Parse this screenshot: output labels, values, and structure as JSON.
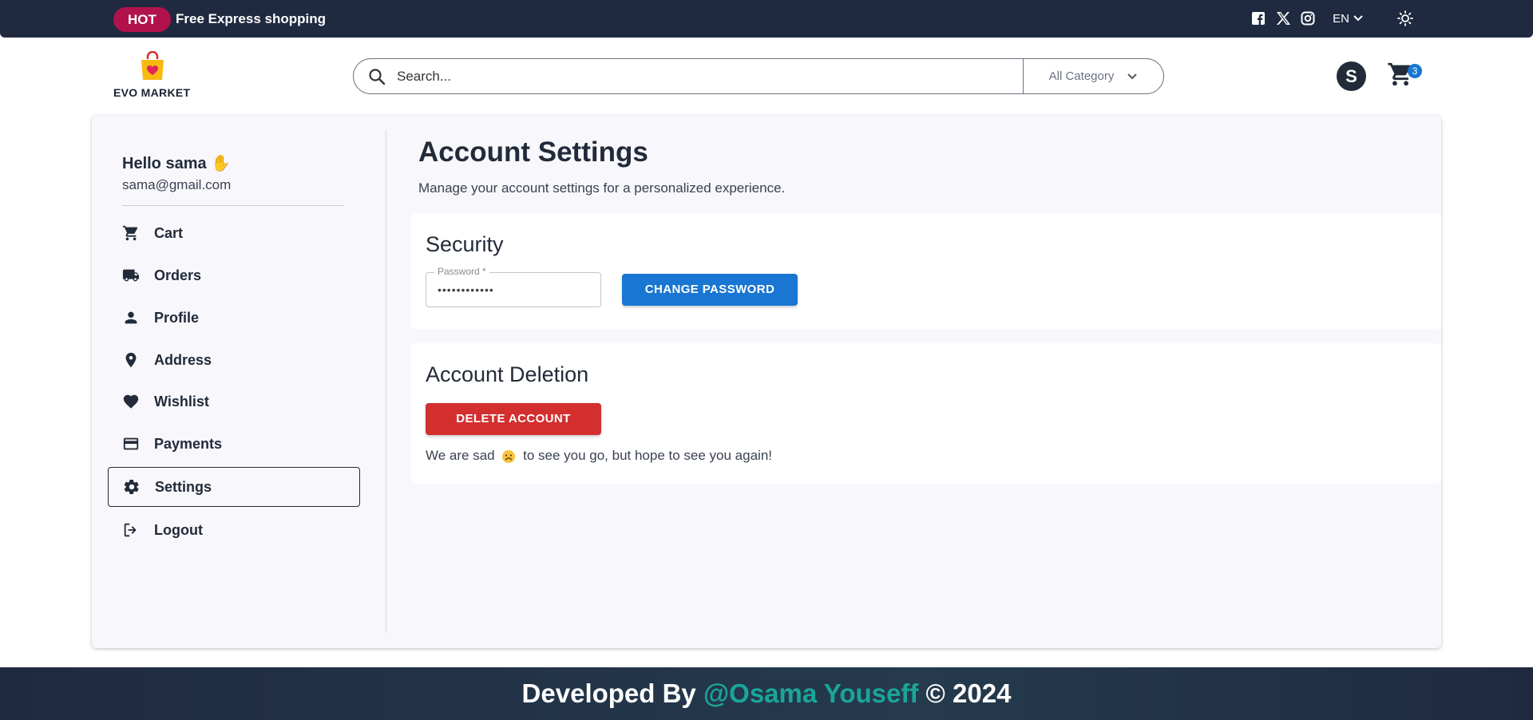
{
  "topbar": {
    "hot_badge": "HOT",
    "promo": "Free Express shopping",
    "language": "EN"
  },
  "header": {
    "brand": "EVO MARKET",
    "search_placeholder": "Search...",
    "category": "All Category",
    "avatar_initial": "S",
    "cart_count": "3"
  },
  "sidebar": {
    "greeting": "Hello sama ✋",
    "email": "sama@gmail.com",
    "items": [
      {
        "label": "Cart",
        "icon": "cart-icon"
      },
      {
        "label": "Orders",
        "icon": "truck-icon"
      },
      {
        "label": "Profile",
        "icon": "person-icon"
      },
      {
        "label": "Address",
        "icon": "location-pin-icon"
      },
      {
        "label": "Wishlist",
        "icon": "heart-icon"
      },
      {
        "label": "Payments",
        "icon": "credit-card-icon"
      },
      {
        "label": "Settings",
        "icon": "gear-icon",
        "active": true
      },
      {
        "label": "Logout",
        "icon": "logout-icon"
      }
    ]
  },
  "main": {
    "title": "Account Settings",
    "subtitle": "Manage your account settings for a personalized experience.",
    "security": {
      "title": "Security",
      "password_label": "Password *",
      "password_value": "••••••••••••",
      "change_button": "CHANGE PASSWORD"
    },
    "deletion": {
      "title": "Account Deletion",
      "delete_button": "DELETE ACCOUNT",
      "message_before": "We are sad",
      "message_after": "to see you go, but hope to see you again!"
    }
  },
  "footer": {
    "prefix": "Developed By",
    "author": "@Osama Youseff",
    "suffix": "© 2024"
  },
  "colors": {
    "topbar": "#1f2a40",
    "hot_badge": "#b2124b",
    "primary": "#1976d2",
    "danger": "#d32f2f",
    "footer_accent": "#1aa59a"
  }
}
